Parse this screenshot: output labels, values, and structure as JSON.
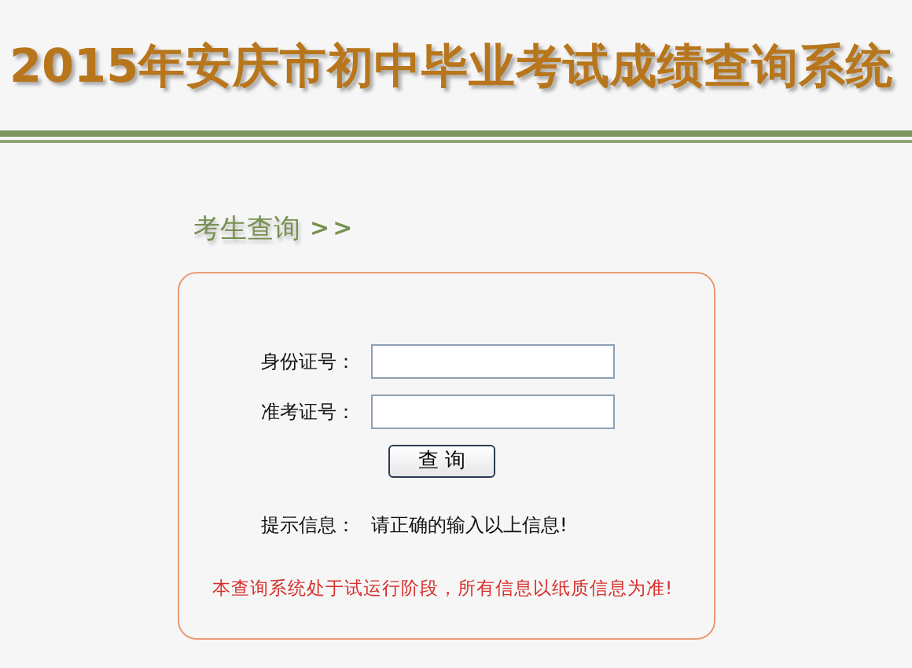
{
  "header": {
    "title": "2015年安庆市初中毕业考试成绩查询系统"
  },
  "section": {
    "title": "考生查询",
    "arrows": ">>"
  },
  "form": {
    "fields": [
      {
        "label": "身份证号："
      },
      {
        "label": "准考证号："
      }
    ],
    "submit": "查 询",
    "hint": {
      "label": "提示信息：",
      "text": "请正确的输入以上信息!"
    },
    "notice": "本查询系统处于试运行阶段，所有信息以纸质信息为准!"
  }
}
